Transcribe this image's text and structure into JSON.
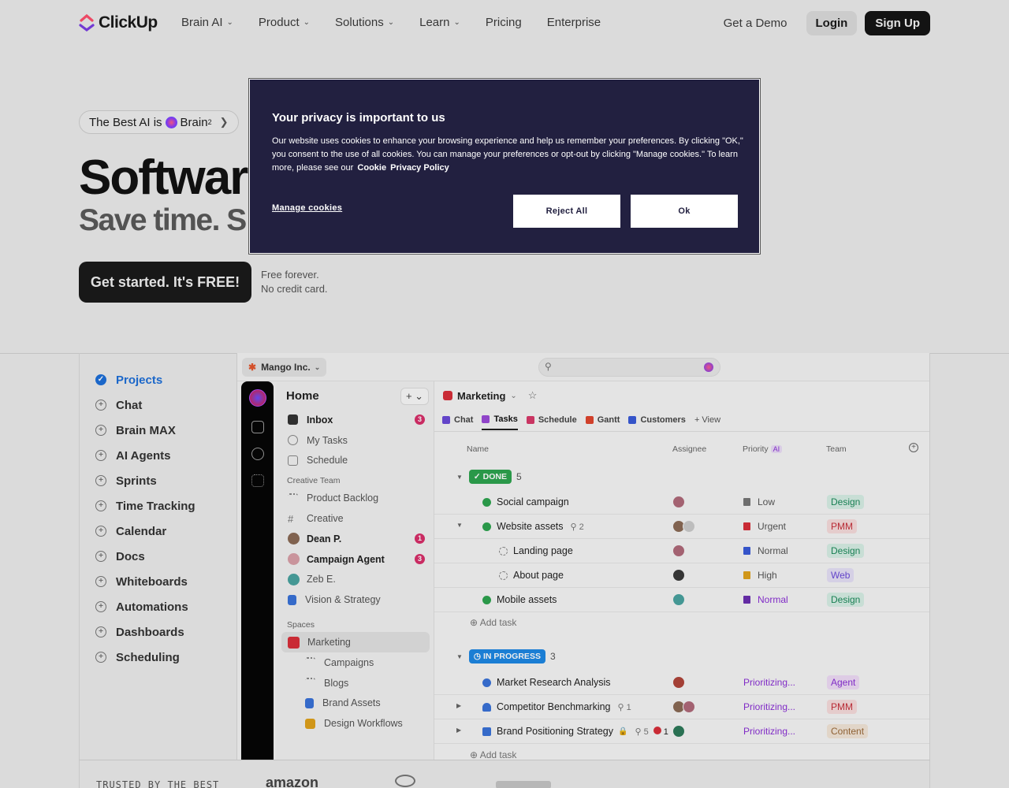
{
  "nav": {
    "brand": "ClickUp",
    "menu": [
      {
        "label": "Brain AI",
        "dropdown": true
      },
      {
        "label": "Product",
        "dropdown": true
      },
      {
        "label": "Solutions",
        "dropdown": true
      },
      {
        "label": "Learn",
        "dropdown": true
      },
      {
        "label": "Pricing",
        "dropdown": false
      },
      {
        "label": "Enterprise",
        "dropdown": false
      }
    ],
    "demo": "Get a Demo",
    "login": "Login",
    "signup": "Sign Up"
  },
  "hero": {
    "pill_prefix": "The Best AI is",
    "pill_brand": "Brain",
    "pill_sup": "2",
    "title": "Softwar",
    "subtitle": "Save time. S",
    "cta": "Get started. It's FREE!",
    "note_line1": "Free forever.",
    "note_line2": "No credit card."
  },
  "features": [
    "Projects",
    "Chat",
    "Brain MAX",
    "AI Agents",
    "Sprints",
    "Time Tracking",
    "Calendar",
    "Docs",
    "Whiteboards",
    "Automations",
    "Dashboards",
    "Scheduling"
  ],
  "app": {
    "workspace": "Mango Inc.",
    "home": {
      "title": "Home",
      "plus": "+",
      "items": [
        {
          "label": "Inbox",
          "bold": true,
          "badge": "3"
        },
        {
          "label": "My Tasks",
          "bold": false
        },
        {
          "label": "Schedule",
          "bold": false
        }
      ],
      "section_team": "Creative Team",
      "team_items": [
        {
          "label": "Product Backlog"
        },
        {
          "label": "Creative"
        },
        {
          "label": "Dean P.",
          "badge": "1"
        },
        {
          "label": "Campaign Agent",
          "badge": "3"
        },
        {
          "label": "Zeb E."
        },
        {
          "label": "Vision & Strategy"
        }
      ],
      "section_spaces": "Spaces",
      "space_items": [
        {
          "label": "Marketing"
        },
        {
          "label": "Campaigns"
        },
        {
          "label": "Blogs"
        },
        {
          "label": "Brand Assets"
        },
        {
          "label": "Design Workflows"
        }
      ]
    },
    "list": {
      "title": "Marketing",
      "tabs": [
        "Chat",
        "Tasks",
        "Schedule",
        "Gantt",
        "Customers",
        "+ View"
      ],
      "columns": {
        "name": "Name",
        "assignee": "Assignee",
        "priority": "Priority",
        "priority_ai": "AI",
        "team": "Team"
      },
      "done_label": "DONE",
      "done_count": "5",
      "progress_label": "IN PROGRESS",
      "progress_count": "3",
      "add_task": "Add task",
      "done_rows": [
        {
          "name": "Social campaign",
          "priority": "Low",
          "team": "Design"
        },
        {
          "name": "Website assets",
          "meta": "2",
          "priority": "Urgent",
          "team": "PMM"
        },
        {
          "name": "Landing page",
          "priority": "Normal",
          "team": "Design"
        },
        {
          "name": "About page",
          "priority": "High",
          "team": "Web"
        },
        {
          "name": "Mobile assets",
          "priority": "Normal",
          "team": "Design"
        }
      ],
      "progress_rows": [
        {
          "name": "Market Research Analysis",
          "priority": "Prioritizing...",
          "team": "Agent"
        },
        {
          "name": "Competitor Benchmarking",
          "meta": "1",
          "priority": "Prioritizing...",
          "team": "PMM"
        },
        {
          "name": "Brand Positioning Strategy",
          "meta": "5",
          "meta2": "1",
          "priority": "Prioritizing...",
          "team": "Content"
        }
      ]
    }
  },
  "trusted": {
    "label": "TRUSTED BY THE BEST",
    "logo1": "amazon"
  },
  "cookie": {
    "title": "Your privacy is important to us",
    "text": "Our website uses cookies to enhance your browsing experience and help us remember your preferences. By clicking \"OK,\" you consent to the use of all cookies. You can manage your preferences or opt-out by clicking \"Manage cookies.\" To learn more, please see our",
    "link_cookie": "Cookie",
    "link_privacy": "Privacy Policy",
    "manage": "Manage cookies",
    "reject": "Reject All",
    "ok": "Ok"
  },
  "colors": {
    "accent_blue": "#1e6fd9",
    "cookie_bg": "#222040",
    "done_green": "#2ea44f",
    "progress_blue": "#1e88e5",
    "badge_pink": "#d92f6a"
  }
}
